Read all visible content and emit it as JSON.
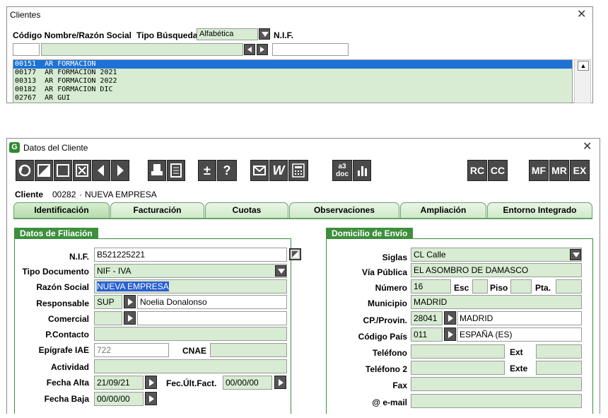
{
  "clientes": {
    "title": "Clientes",
    "close": "✕",
    "col_codigo": "Código Nombre/Razón Social",
    "tipo_busqueda_label": "Tipo Búsqueda",
    "tipo_busqueda_value": "Alfabética",
    "nif_label": "N.I.F.",
    "rows": [
      {
        "code": "00151",
        "name": "AR FORMACION"
      },
      {
        "code": "00177",
        "name": "AR FORMACION 2021"
      },
      {
        "code": "00313",
        "name": "AR FORMACION 2022"
      },
      {
        "code": "00182",
        "name": "AR FORMACION DIC"
      },
      {
        "code": "02767",
        "name": "AR GUI"
      }
    ],
    "scroll_up": "▲"
  },
  "datos": {
    "title": "Datos del Cliente",
    "close": "✕",
    "toolbar_right": [
      "RC",
      "CC",
      "MF",
      "MR",
      "EX"
    ],
    "toolbar_text": {
      "w": "W",
      "a3": "a3",
      "doc": "doc",
      "pm": "±",
      "q": "?"
    },
    "cliente_label": "Cliente",
    "cliente_code": "00282",
    "cliente_sep": "·",
    "cliente_name": "NUEVA EMPRESA",
    "tabs": [
      "Identificación",
      "Facturación",
      "Cuotas",
      "Observaciones",
      "Ampliación",
      "Entorno Integrado"
    ],
    "filiacion": {
      "header": "Datos de Filiación",
      "nif_label": "N.I.F.",
      "nif": "B521225221",
      "tipo_doc_label": "Tipo Documento",
      "tipo_doc": "NIF - IVA",
      "razon_label": "Razón Social",
      "razon": "NUEVA EMPRESA",
      "resp_label": "Responsable",
      "resp_code": "SUP",
      "resp_name": "Noelia Donalonso",
      "comercial_label": "Comercial",
      "contacto_label": "P.Contacto",
      "epigrafe_label": "Epígrafe IAE",
      "epigrafe": "722",
      "cnae_label": "CNAE",
      "actividad_label": "Actividad",
      "alta_label": "Fecha Alta",
      "alta": "21/09/21",
      "ult_fact_label": "Fec.Últ.Fact.",
      "ult_fact": "00/00/00",
      "baja_label": "Fecha Baja",
      "baja": "00/00/00"
    },
    "domicilio": {
      "header": "Domicilio de Envío",
      "siglas_label": "Siglas",
      "siglas": "CL Calle",
      "via_label": "Vía Pública",
      "via": "EL ASOMBRO DE DAMASCO",
      "numero_label": "Número",
      "numero": "16",
      "esc_label": "Esc",
      "piso_label": "Piso",
      "pta_label": "Pta.",
      "municipio_label": "Municipio",
      "municipio": "MADRID",
      "cp_label": "CP./Provin.",
      "cp": "28041",
      "provincia": "MADRID",
      "pais_label": "Código País",
      "pais_code": "011",
      "pais": "ESPAÑA (ES)",
      "tel_label": "Teléfono",
      "ext_label": "Ext",
      "tel2_label": "Teléfono 2",
      "exte_label": "Exte",
      "fax_label": "Fax",
      "email_label": "@ e-mail"
    }
  }
}
